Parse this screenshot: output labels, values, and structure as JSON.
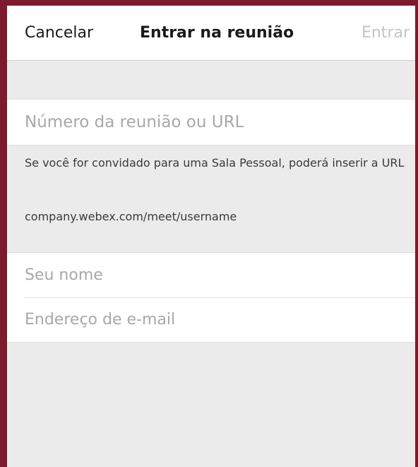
{
  "nav": {
    "cancel_label": "Cancelar",
    "title": "Entrar na reunião",
    "join_label": "Entrar"
  },
  "meeting": {
    "placeholder": "Número da reunião ou URL",
    "value": ""
  },
  "help": {
    "text": "Se você for convidado para uma Sala Pessoal, poderá inserir a URL",
    "url_example": "company.webex.com/meet/username"
  },
  "identity": {
    "name_placeholder": "Seu nome",
    "name_value": "",
    "email_placeholder": "Endereço de e-mail",
    "email_value": ""
  },
  "colors": {
    "frame_border": "#7d1a2d",
    "background": "#ebebeb",
    "disabled_text": "#c4c4c4"
  }
}
